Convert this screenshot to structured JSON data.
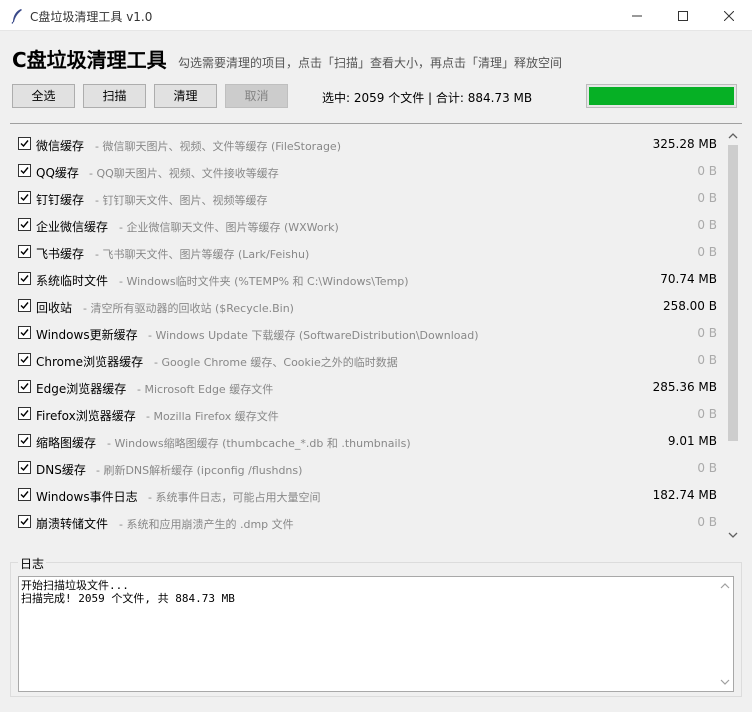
{
  "window": {
    "title": "C盘垃圾清理工具 v1.0"
  },
  "header": {
    "heading": "C盘垃圾清理工具",
    "subtitle": "勾选需要清理的项目，点击「扫描」查看大小，再点击「清理」释放空间"
  },
  "toolbar": {
    "select_all": "全选",
    "scan": "扫描",
    "clean": "清理",
    "cancel": "取消",
    "stats": "选中: 2059 个文件 | 合计: 884.73 MB",
    "progress": 1.0
  },
  "colors": {
    "progress_fill": "#06b025",
    "zero_size": "#aaaaaa",
    "description": "#888888"
  },
  "items": [
    {
      "name": "微信缓存",
      "desc": "- 微信聊天图片、视频、文件等缓存 (FileStorage)",
      "size": "325.28 MB",
      "checked": true
    },
    {
      "name": "QQ缓存",
      "desc": "- QQ聊天图片、视频、文件接收等缓存",
      "size": "0 B",
      "checked": true
    },
    {
      "name": "钉钉缓存",
      "desc": "- 钉钉聊天文件、图片、视频等缓存",
      "size": "0 B",
      "checked": true
    },
    {
      "name": "企业微信缓存",
      "desc": "- 企业微信聊天文件、图片等缓存 (WXWork)",
      "size": "0 B",
      "checked": true
    },
    {
      "name": "飞书缓存",
      "desc": "- 飞书聊天文件、图片等缓存 (Lark/Feishu)",
      "size": "0 B",
      "checked": true
    },
    {
      "name": "系统临时文件",
      "desc": "- Windows临时文件夹 (%TEMP% 和 C:\\Windows\\Temp)",
      "size": "70.74 MB",
      "checked": true
    },
    {
      "name": "回收站",
      "desc": "- 清空所有驱动器的回收站 ($Recycle.Bin)",
      "size": "258.00 B",
      "checked": true
    },
    {
      "name": "Windows更新缓存",
      "desc": "- Windows Update 下载缓存 (SoftwareDistribution\\Download)",
      "size": "0 B",
      "checked": true
    },
    {
      "name": "Chrome浏览器缓存",
      "desc": "- Google Chrome 缓存、Cookie之外的临时数据",
      "size": "0 B",
      "checked": true
    },
    {
      "name": "Edge浏览器缓存",
      "desc": "- Microsoft Edge 缓存文件",
      "size": "285.36 MB",
      "checked": true
    },
    {
      "name": "Firefox浏览器缓存",
      "desc": "- Mozilla Firefox 缓存文件",
      "size": "0 B",
      "checked": true
    },
    {
      "name": "缩略图缓存",
      "desc": "- Windows缩略图缓存 (thumbcache_*.db 和 .thumbnails)",
      "size": "9.01 MB",
      "checked": true
    },
    {
      "name": "DNS缓存",
      "desc": "- 刷新DNS解析缓存 (ipconfig /flushdns)",
      "size": "0 B",
      "checked": true
    },
    {
      "name": "Windows事件日志",
      "desc": "- 系统事件日志，可能占用大量空间",
      "size": "182.74 MB",
      "checked": true
    },
    {
      "name": "崩溃转储文件",
      "desc": "- 系统和应用崩溃产生的 .dmp 文件",
      "size": "0 B",
      "checked": true
    }
  ],
  "log": {
    "label": "日志",
    "lines": [
      "开始扫描垃圾文件...",
      "扫描完成! 2059 个文件, 共 884.73 MB"
    ]
  }
}
